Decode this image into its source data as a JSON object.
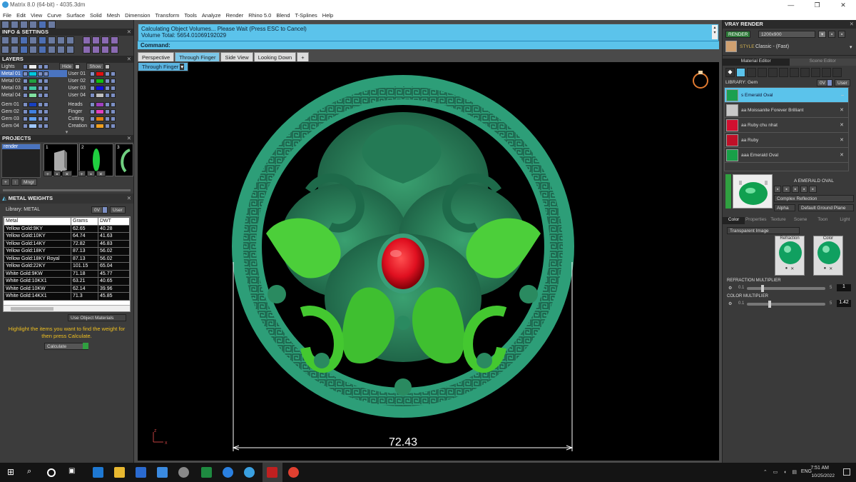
{
  "window": {
    "title": "Matrix 8.0 (64-bit) - 4035.3dm",
    "controls": [
      "—",
      "❐",
      "✕"
    ]
  },
  "menu": [
    "File",
    "Edit",
    "View",
    "Curve",
    "Surface",
    "Solid",
    "Mesh",
    "Dimension",
    "Transform",
    "Tools",
    "Analyze",
    "Render",
    "Rhino 5.0",
    "Blend",
    "T-Splines",
    "Help"
  ],
  "left": {
    "info_settings": "INFO & SETTINGS",
    "layers_title": "LAYERS",
    "lights_label": "Lights",
    "hide_label": "Hide",
    "show_label": "Show",
    "layers_left": [
      {
        "name": "Metal 01",
        "color": "#00c8e0",
        "selected": true
      },
      {
        "name": "Metal 02",
        "color": "#22a040"
      },
      {
        "name": "Metal 03",
        "color": "#40c8a0"
      },
      {
        "name": "Metal 04",
        "color": "#80e0a0"
      },
      {
        "name": "Gem 01",
        "color": "#1840c0"
      },
      {
        "name": "Gem 02",
        "color": "#4080e0"
      },
      {
        "name": "Gem 03",
        "color": "#60a0f0"
      },
      {
        "name": "Gem 04",
        "color": "#a0c8ff"
      }
    ],
    "layers_right": [
      {
        "name": "User 01",
        "color": "#e01010"
      },
      {
        "name": "User 02",
        "color": "#10c010"
      },
      {
        "name": "User 03",
        "color": "#1010e0"
      },
      {
        "name": "User 04",
        "color": "#c0c0c0"
      },
      {
        "name": "Heads",
        "color": "#a040c0"
      },
      {
        "name": "Finger",
        "color": "#e040c0"
      },
      {
        "name": "Cutting",
        "color": "#e08010"
      },
      {
        "name": "Creation",
        "color": "#f0a020"
      }
    ],
    "projects_title": "PROJECTS",
    "project_name": "render",
    "project_slots": [
      "1",
      "2",
      "3"
    ],
    "mngr_label": "Mngr",
    "metal_weights_title": "METAL WEIGHTS",
    "library_label": "Library: METAL",
    "metal_headers": [
      "Metal",
      "Grams",
      "DWT"
    ],
    "metals": [
      [
        "Yellow Gold:9KY",
        "62.65",
        "40.28"
      ],
      [
        "Yellow Gold:10KY",
        "64.74",
        "41.63"
      ],
      [
        "Yellow Gold:14KY",
        "72.82",
        "46.83"
      ],
      [
        "Yellow Gold:18KY",
        "87.13",
        "56.02"
      ],
      [
        "Yellow Gold:18KY Royal",
        "87.13",
        "56.02"
      ],
      [
        "Yellow Gold:22KY",
        "101.15",
        "65.04"
      ],
      [
        "White Gold:9KW",
        "71.18",
        "45.77"
      ],
      [
        "White Gold:10KX1",
        "63.21",
        "40.65"
      ],
      [
        "White Gold:10KW",
        "62.14",
        "39.96"
      ],
      [
        "White Gold:14KX1",
        "71.3",
        "45.85"
      ]
    ],
    "use_object_materials": "Use Object Materials",
    "hint": "Highlight the items you want to find the weight for then press Calculate.",
    "calculate_label": "Calculate"
  },
  "command": {
    "line1": "Calculating Object Volumes... Please Wait (Press ESC to Cancel)",
    "line2": "Volume Total: 5654.01069192029",
    "prompt": "Command:"
  },
  "tabs": [
    "Perspective",
    "Through Finger",
    "Side View",
    "Looking Down",
    "+"
  ],
  "active_tab": 1,
  "viewport": {
    "label": "Through Finger",
    "dimension": "72.43",
    "axis_z": "z",
    "axis_x": "x"
  },
  "right": {
    "title": "VRAY RENDER",
    "render_label": "RENDER",
    "resolution": "1200x900",
    "style_label": "STYLE",
    "style_value": "Classic - (Fast)",
    "material_editor_tab": "Material Editor",
    "scene_editor_tab": "Scene Editor",
    "library_label": "LIBRARY: Gem",
    "library_btns": [
      "0V",
      "User"
    ],
    "materials": [
      {
        "name": "s Emerald Oval",
        "color": "#1aa050",
        "selected": true
      },
      {
        "name": "aa Moissanite Forever Brilliant",
        "color": "#c8c8c8"
      },
      {
        "name": "aa Ruby chu nhat",
        "color": "#d01030"
      },
      {
        "name": "aa Ruby",
        "color": "#c01028"
      },
      {
        "name": "aaa Emerald Oval",
        "color": "#18a048"
      }
    ],
    "preview_title": "A EMERALD OVAL",
    "complex_reflection": "Complex Reflection",
    "alpha_label": "Alpha",
    "ground_plane": "Default Ground Plane",
    "sub_tabs": [
      "Color",
      "Properties",
      "Texture",
      "Scene",
      "Toon",
      "Light"
    ],
    "transparent_image": "Transparent Image",
    "refraction_label": "Refraction",
    "color_label": "Color",
    "refraction_multiplier_label": "REFRACTION MULTIPLIER",
    "refraction_min": "0.1",
    "refraction_max": "5",
    "refraction_value": "1",
    "refraction_level": 0.18,
    "color_multiplier_label": "COLOR MULTIPLIER",
    "color_min": "0.1",
    "color_max": "5",
    "color_value": "1.42",
    "color_level": 0.27
  },
  "taskbar": {
    "lang": "ENG",
    "time": "7:51 AM",
    "date": "10/25/2022"
  },
  "colors": {
    "cmd_bg": "#5bc3eb",
    "ring_green": "#2d9e78",
    "ruby": "#e01020"
  }
}
